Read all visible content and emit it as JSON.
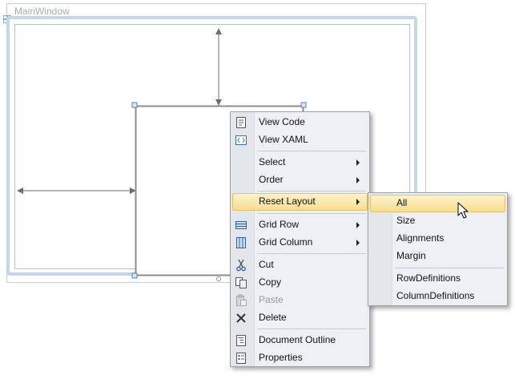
{
  "window": {
    "title": "MainWindow"
  },
  "context_menu": {
    "items": [
      {
        "label": "View Code",
        "icon": "view-code-icon"
      },
      {
        "label": "View XAML",
        "icon": "view-xaml-icon"
      },
      {
        "label": "Select"
      },
      {
        "label": "Order"
      },
      {
        "label": "Reset Layout"
      },
      {
        "label": "Grid Row",
        "icon": "grid-row-icon"
      },
      {
        "label": "Grid Column",
        "icon": "grid-column-icon"
      },
      {
        "label": "Cut",
        "icon": "scissors-icon"
      },
      {
        "label": "Copy",
        "icon": "copy-icon"
      },
      {
        "label": "Paste",
        "icon": "paste-icon",
        "disabled": true
      },
      {
        "label": "Delete",
        "icon": "delete-icon"
      },
      {
        "label": "Document Outline",
        "icon": "document-outline-icon"
      },
      {
        "label": "Properties",
        "icon": "properties-icon"
      }
    ]
  },
  "submenu": {
    "parent": "Reset Layout",
    "items": [
      {
        "label": "All",
        "highlighted": true
      },
      {
        "label": "Size"
      },
      {
        "label": "Alignments"
      },
      {
        "label": "Margin"
      },
      {
        "label": "RowDefinitions"
      },
      {
        "label": "ColumnDefinitions"
      }
    ]
  },
  "colors": {
    "highlight": "#f7dd92",
    "window_border": "#c2d6ed",
    "menu_background": "#eef0f4"
  }
}
